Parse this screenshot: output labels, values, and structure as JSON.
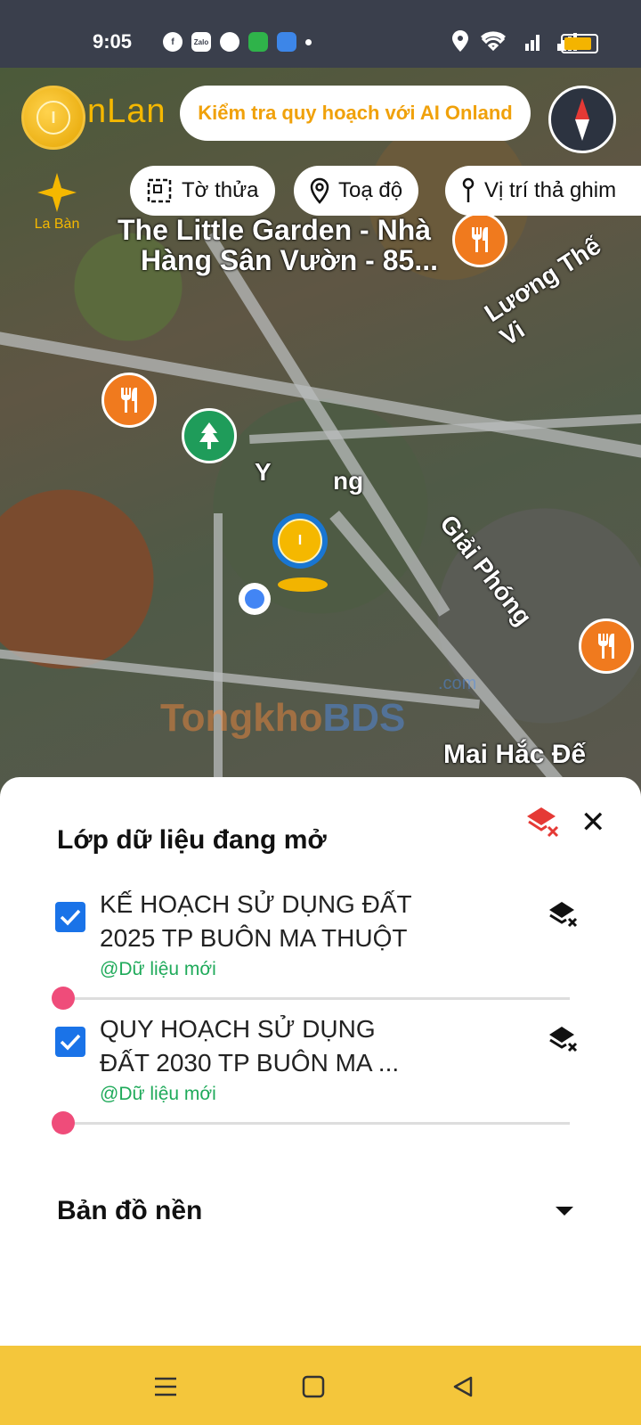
{
  "status_bar": {
    "time": "9:05",
    "apps": [
      "f",
      "Zalo"
    ]
  },
  "header": {
    "logo_text": "nLan",
    "ai_banner": "Kiểm tra quy hoạch với AI Onland",
    "compass_label": "La Bàn"
  },
  "chips": [
    {
      "label": "Tờ thửa",
      "icon": "parcel-icon"
    },
    {
      "label": "Toạ độ",
      "icon": "location-pin-icon"
    },
    {
      "label": "Vị trí thả ghim",
      "icon": "pushpin-icon"
    }
  ],
  "map": {
    "labels": {
      "garden_line1": "The Little Garden - Nhà",
      "garden_line2": "Hàng Sân Vườn - 85...",
      "luong_the_vinh": "Lương Thế Vi",
      "y_ngong": "Y",
      "y_ngong_end": "ng",
      "giai_phong": "Giải Phóng",
      "mai_hac_de": "Mai Hắc Đế"
    },
    "watermark_main": "Tongkho",
    "watermark_bds": "BDS",
    "watermark_com": ".com",
    "accent_food": "#f07a1e",
    "accent_park": "#1f9c5a"
  },
  "panel": {
    "title": "Lớp dữ liệu đang mở",
    "layers": [
      {
        "name_line1": "KẾ HOẠCH SỬ DỤNG ĐẤT",
        "name_line2": "2025 TP BUÔN MA THUỘT",
        "subtitle": "@Dữ liệu mới",
        "checked": true,
        "opacity": 0
      },
      {
        "name_line1": "QUY HOẠCH SỬ DỤNG",
        "name_line2": "ĐẤT 2030 TP BUÔN MA ...",
        "subtitle": "@Dữ liệu mới",
        "checked": true,
        "opacity": 0
      }
    ],
    "base_map_title": "Bản đồ nền"
  },
  "colors": {
    "brand": "#f5b800",
    "checkbox": "#1a73e8",
    "slider_thumb": "#ef4c7a",
    "subtitle": "#1faa5a",
    "navbar": "#f4c63b"
  }
}
